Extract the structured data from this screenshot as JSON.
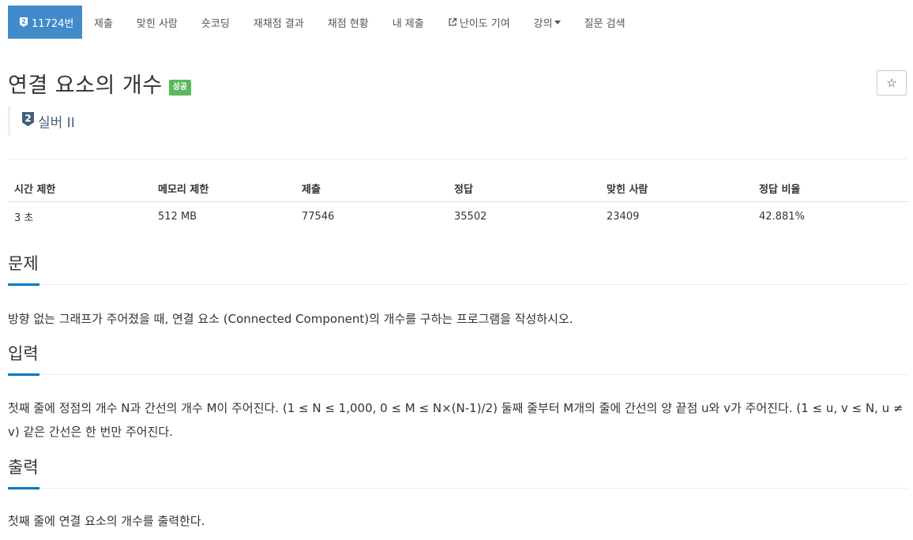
{
  "nav": {
    "problem_number": "11724번",
    "items": [
      "제출",
      "맞힌 사람",
      "숏코딩",
      "재채점 결과",
      "채점 현황",
      "내 제출"
    ],
    "contribute": "난이도 기여",
    "lecture": "강의",
    "search": "질문 검색"
  },
  "problem": {
    "title": "연결 요소의 개수",
    "status": "성공",
    "tier": "실버 II",
    "tier_number": "2",
    "star": "☆"
  },
  "stats": {
    "headers": [
      "시간 제한",
      "메모리 제한",
      "제출",
      "정답",
      "맞힌 사람",
      "정답 비율"
    ],
    "values": [
      "3 초",
      "512 MB",
      "77546",
      "35502",
      "23409",
      "42.881%"
    ]
  },
  "sections": {
    "description": {
      "title": "문제",
      "body": "방향 없는 그래프가 주어졌을 때, 연결 요소 (Connected Component)의 개수를 구하는 프로그램을 작성하시오."
    },
    "input": {
      "title": "입력",
      "body": "첫째 줄에 정점의 개수 N과 간선의 개수 M이 주어진다. (1 ≤ N ≤ 1,000, 0 ≤ M ≤ N×(N-1)/2) 둘째 줄부터 M개의 줄에 간선의 양 끝점 u와 v가 주어진다. (1 ≤ u, v ≤ N, u ≠ v) 같은 간선은 한 번만 주어진다."
    },
    "output": {
      "title": "출력",
      "body": "첫째 줄에 연결 요소의 개수를 출력한다."
    }
  },
  "colors": {
    "active_tab": "#428bca",
    "success_badge": "#5cb85c",
    "tier_silver": "#435f7a",
    "section_accent": "#0076c0"
  }
}
